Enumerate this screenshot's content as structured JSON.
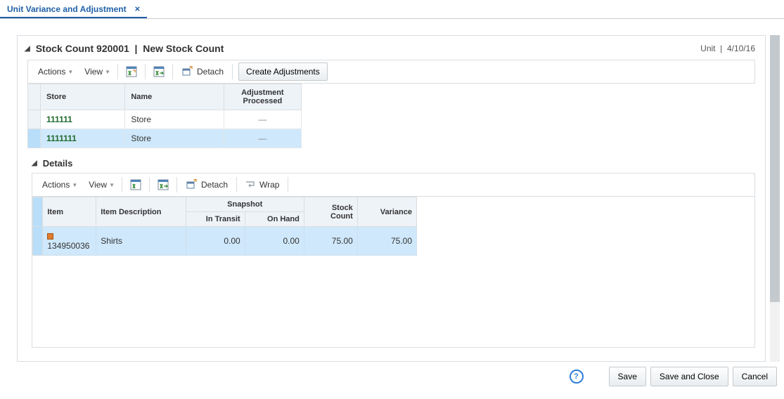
{
  "tab": {
    "title": "Unit Variance and Adjustment"
  },
  "header": {
    "stock_count_label": "Stock Count",
    "stock_count_id": "920001",
    "stock_count_name": "New Stock Count",
    "meta_type": "Unit",
    "meta_date": "4/10/16"
  },
  "toolbar_main": {
    "actions": "Actions",
    "view": "View",
    "detach": "Detach",
    "create_adjustments": "Create Adjustments"
  },
  "stores_table": {
    "columns": {
      "store": "Store",
      "name": "Name",
      "adj_processed": "Adjustment\nProcessed"
    },
    "rows": [
      {
        "store": "111111",
        "name": "Store",
        "adj": "—",
        "selected": false
      },
      {
        "store": "1111111",
        "name": "Store",
        "adj": "—",
        "selected": true
      }
    ]
  },
  "details_panel": {
    "title": "Details"
  },
  "toolbar_details": {
    "actions": "Actions",
    "view": "View",
    "detach": "Detach",
    "wrap": "Wrap"
  },
  "details_table": {
    "columns": {
      "item": "Item",
      "item_desc": "Item Description",
      "snapshot": "Snapshot",
      "in_transit": "In Transit",
      "on_hand": "On Hand",
      "stock_count": "Stock\nCount",
      "variance": "Variance"
    },
    "rows": [
      {
        "item": "134950036",
        "desc": "Shirts",
        "in_transit": "0.00",
        "on_hand": "0.00",
        "stock_count": "75.00",
        "variance": "75.00"
      }
    ]
  },
  "footer": {
    "save": "Save",
    "save_close": "Save and Close",
    "cancel": "Cancel"
  }
}
